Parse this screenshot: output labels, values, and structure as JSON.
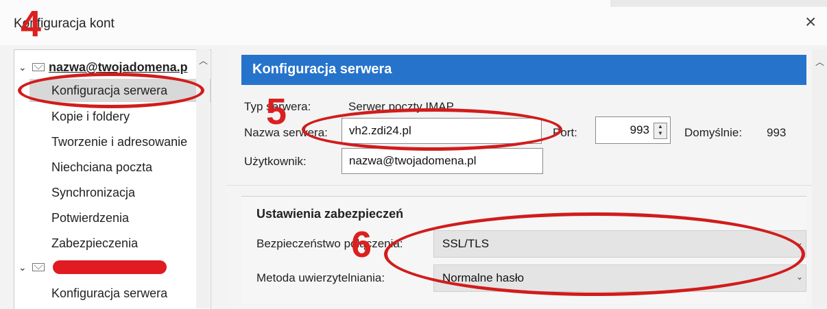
{
  "window": {
    "title": "Konfiguracja kont",
    "close_glyph": "×"
  },
  "tree": {
    "account1": {
      "label": "nazwa@twojadomena.p",
      "icon": "mail-icon"
    },
    "items": [
      "Konfiguracja serwera",
      "Kopie i foldery",
      "Tworzenie i adresowanie",
      "Niechciana poczta",
      "Synchronizacja",
      "Potwierdzenia",
      "Zabezpieczenia"
    ],
    "account2_items": [
      "Konfiguracja serwera"
    ]
  },
  "panel": {
    "header": "Konfiguracja serwera",
    "server_type_label": "Typ serwera:",
    "server_type_value": "Serwer poczty IMAP",
    "server_name_label": "Nazwa serwera:",
    "server_name_value": "vh2.zdi24.pl",
    "port_label": "Port:",
    "port_value": "993",
    "default_label": "Domyślnie:",
    "default_value": "993",
    "user_label": "Użytkownik:",
    "user_value": "nazwa@twojadomena.pl",
    "security": {
      "title": "Ustawienia zabezpieczeń",
      "connection_label": "Bezpieczeństwo połączenia:",
      "connection_value": "SSL/TLS",
      "auth_label": "Metoda uwierzytelniania:",
      "auth_value": "Normalne hasło"
    }
  },
  "annotations": {
    "color": "#d11c1c",
    "step4": "4",
    "step5": "5",
    "step6": "6"
  }
}
